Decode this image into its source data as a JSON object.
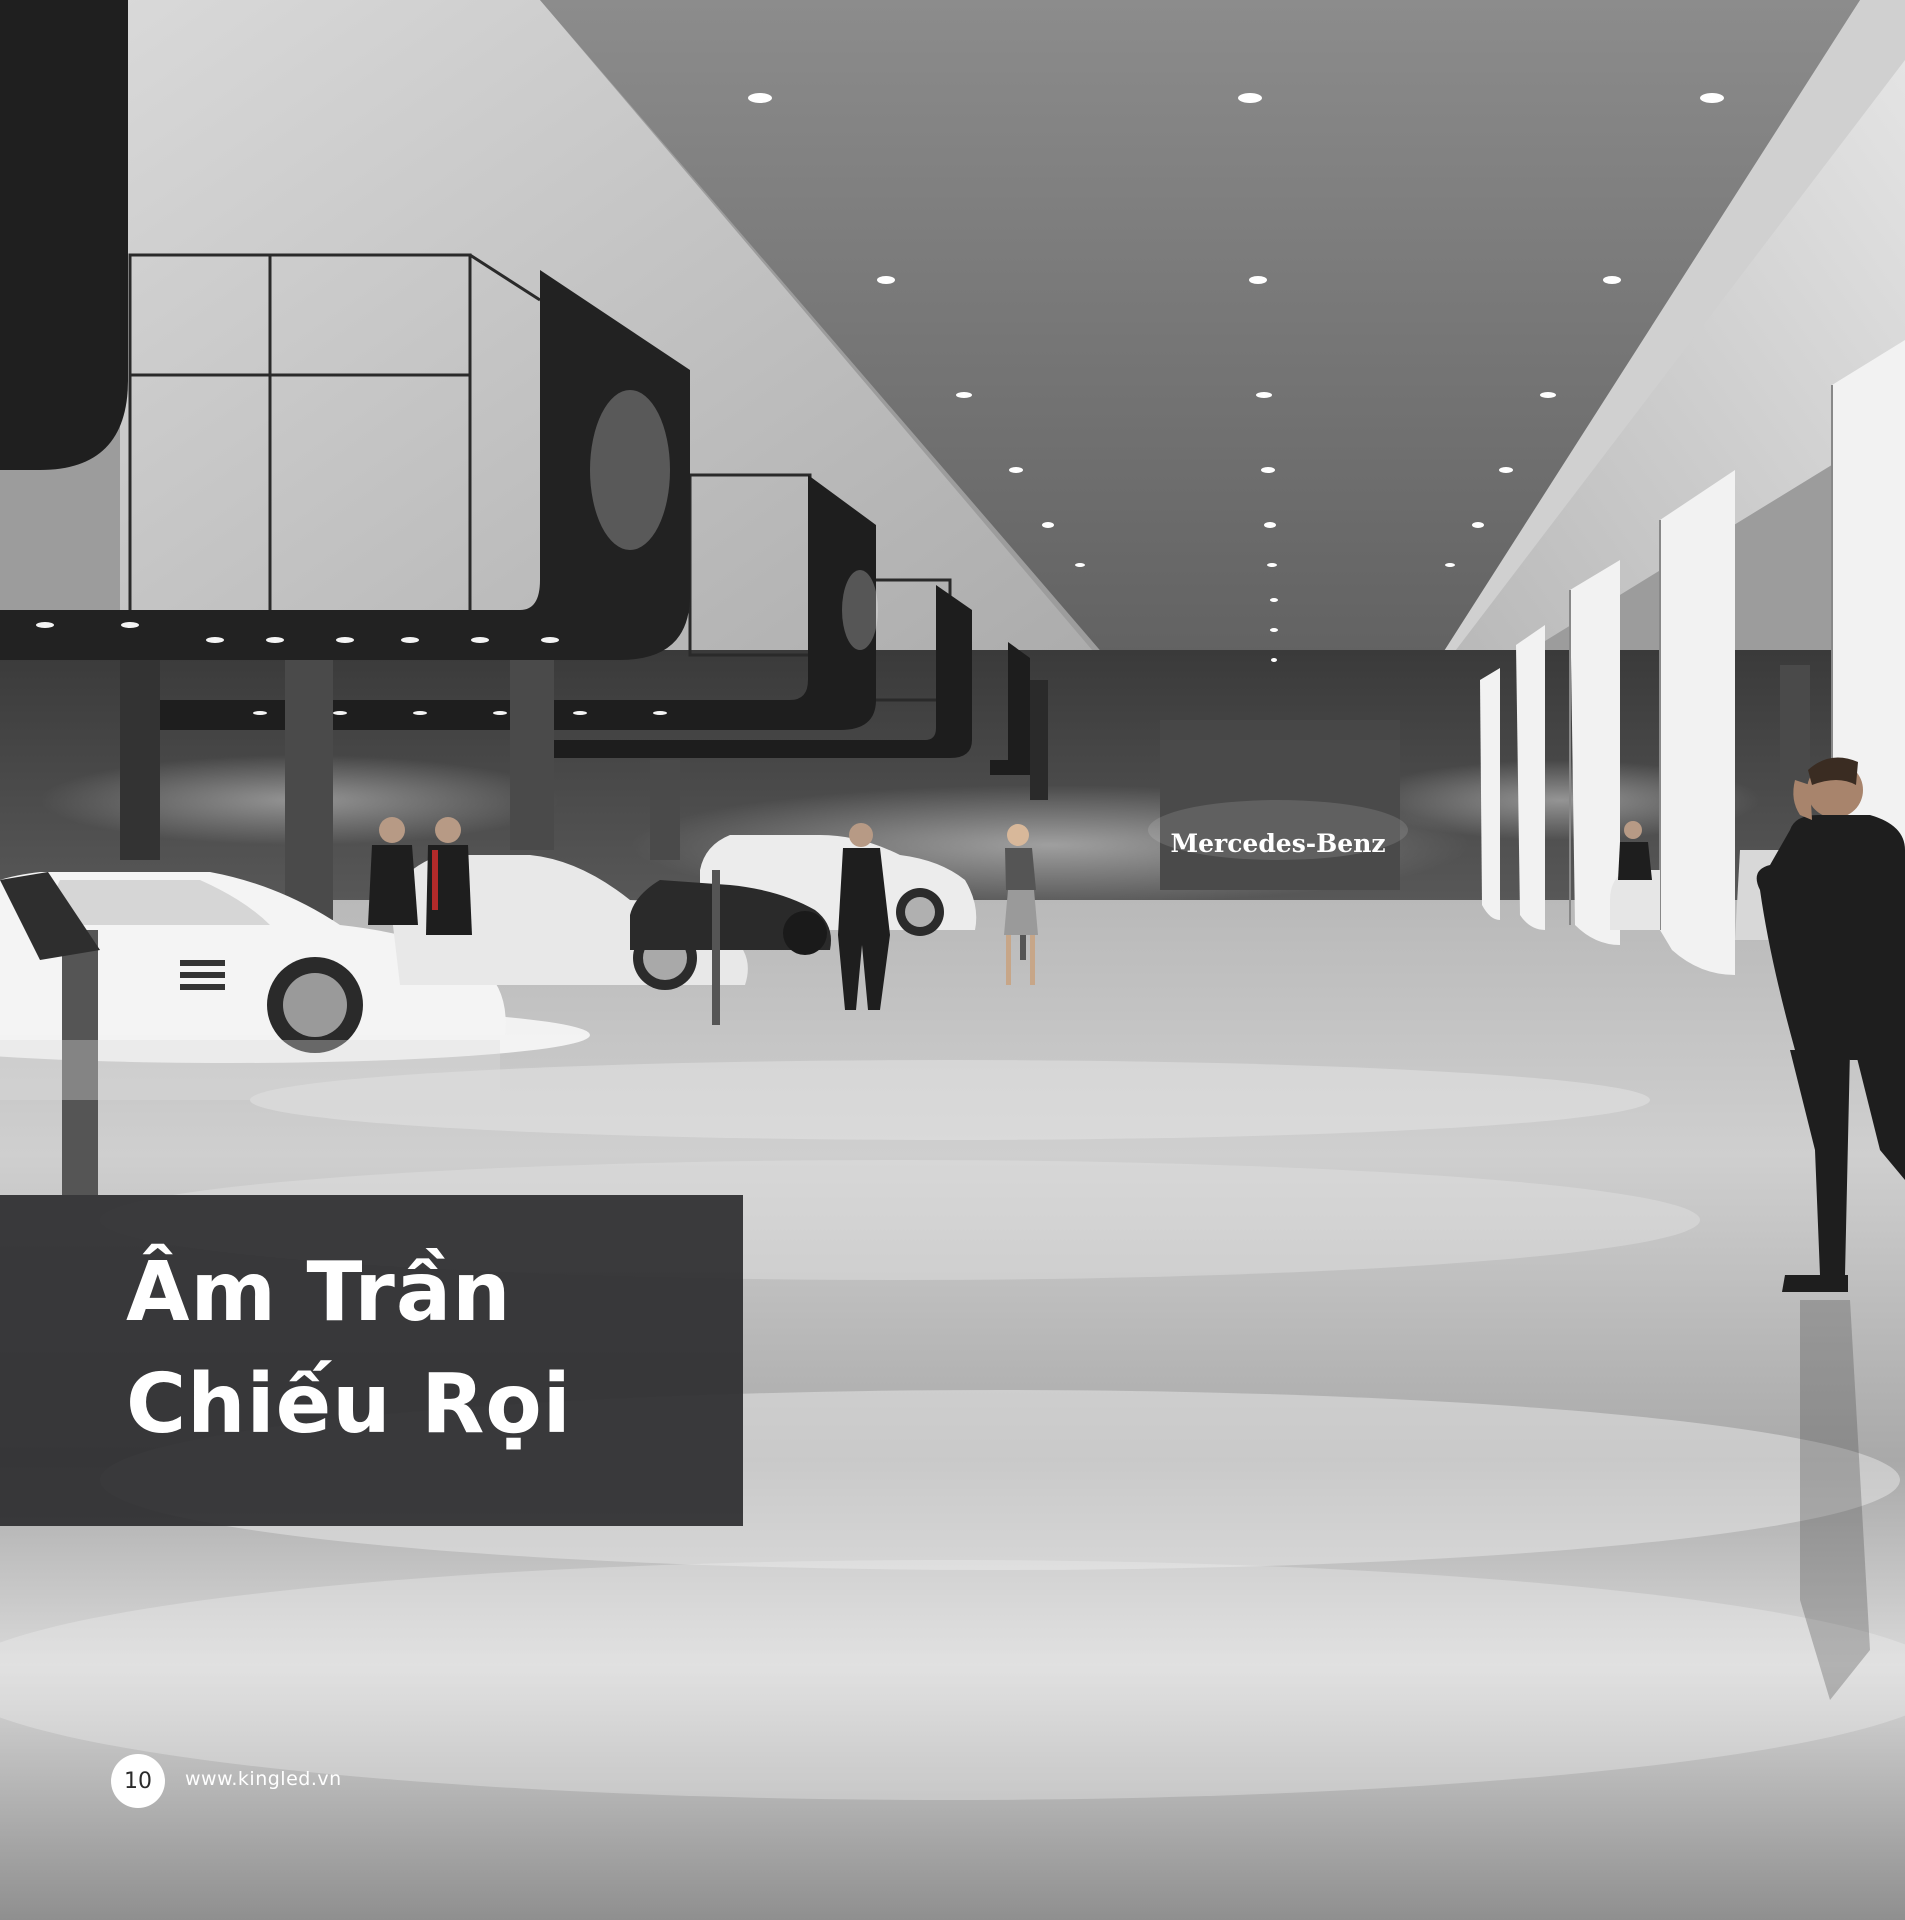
{
  "title": {
    "line1": "Âm Trần",
    "line2": "Chiếu Rọi"
  },
  "footer": {
    "page_number": "10",
    "website": "www.kingled.vn"
  },
  "photo": {
    "sign_text": "Mercedes-Benz"
  },
  "colors": {
    "title_box": "#2d2d2f",
    "title_text": "#ffffff",
    "badge_bg": "#ffffff",
    "badge_text": "#2b2b2b"
  }
}
